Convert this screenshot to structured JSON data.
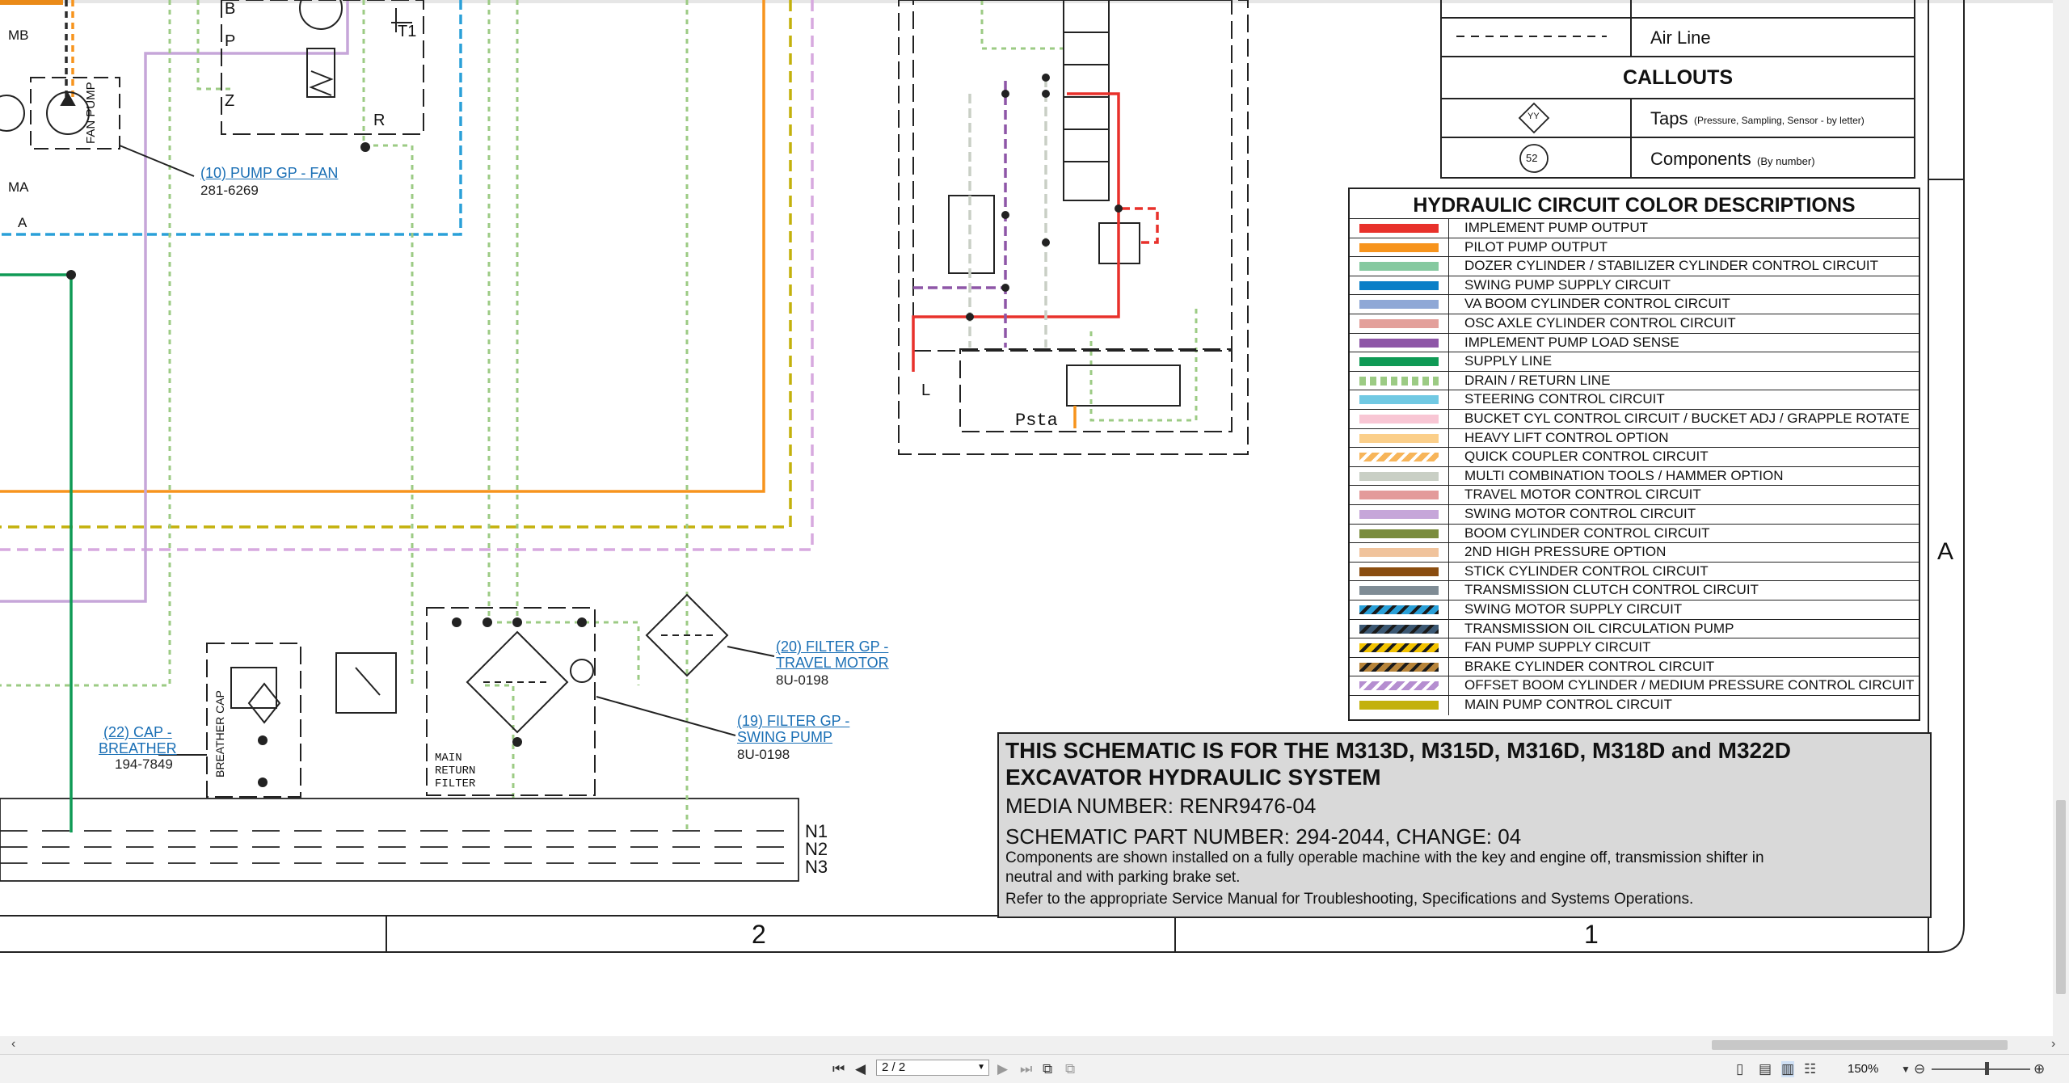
{
  "legend_top": {
    "air_line_label": "Air Line",
    "callouts_header": "CALLOUTS",
    "taps_label": "Taps",
    "taps_note": "(Pressure, Sampling, Sensor - by letter)",
    "taps_symbol": "YY",
    "components_label": "Components",
    "components_note": "(By number)",
    "components_symbol": "52"
  },
  "color_descriptions": {
    "title": "HYDRAULIC CIRCUIT COLOR DESCRIPTIONS",
    "rows": [
      {
        "label": "IMPLEMENT PUMP OUTPUT",
        "color": "#e8312b",
        "pattern": "solid"
      },
      {
        "label": "PILOT PUMP OUTPUT",
        "color": "#f7941d",
        "pattern": "solid"
      },
      {
        "label": "DOZER CYLINDER / STABILIZER CYLINDER CONTROL CIRCUIT",
        "color": "#86c9a0",
        "pattern": "solid"
      },
      {
        "label": "SWING PUMP SUPPLY CIRCUIT",
        "color": "#0b7fc7",
        "pattern": "solid"
      },
      {
        "label": "VA BOOM CYLINDER CONTROL CIRCUIT",
        "color": "#8fa8d6",
        "pattern": "solid"
      },
      {
        "label": "OSC AXLE CYLINDER CONTROL CIRCUIT",
        "color": "#e3a09b",
        "pattern": "solid"
      },
      {
        "label": "IMPLEMENT PUMP LOAD SENSE",
        "color": "#8e56a7",
        "pattern": "solid"
      },
      {
        "label": "SUPPLY LINE",
        "color": "#0f9a55",
        "pattern": "solid"
      },
      {
        "label": "DRAIN / RETURN LINE",
        "color": "#9ccb84",
        "pattern": "dotted"
      },
      {
        "label": "STEERING CONTROL CIRCUIT",
        "color": "#71c9e3",
        "pattern": "solid"
      },
      {
        "label": "BUCKET CYL CONTROL CIRCUIT / BUCKET ADJ / GRAPPLE ROTATE",
        "color": "#f8c6d4",
        "pattern": "solid"
      },
      {
        "label": "HEAVY LIFT CONTROL OPTION",
        "color": "#fbcf8a",
        "pattern": "solid"
      },
      {
        "label": "QUICK COUPLER CONTROL CIRCUIT",
        "color": "#f7b55a",
        "pattern": "hatch"
      },
      {
        "label": "MULTI COMBINATION TOOLS / HAMMER OPTION",
        "color": "#c9cfc5",
        "pattern": "solid"
      },
      {
        "label": "TRAVEL MOTOR CONTROL CIRCUIT",
        "color": "#e39a9a",
        "pattern": "solid"
      },
      {
        "label": "SWING MOTOR CONTROL CIRCUIT",
        "color": "#c6a6d9",
        "pattern": "solid"
      },
      {
        "label": "BOOM CYLINDER CONTROL CIRCUIT",
        "color": "#7a8c3d",
        "pattern": "solid"
      },
      {
        "label": "2ND HIGH PRESSURE OPTION",
        "color": "#f0c39c",
        "pattern": "solid"
      },
      {
        "label": "STICK CYLINDER CONTROL CIRCUIT",
        "color": "#8a4d10",
        "pattern": "solid"
      },
      {
        "label": "TRANSMISSION CLUTCH CONTROL CIRCUIT",
        "color": "#7f8c95",
        "pattern": "solid"
      },
      {
        "label": "SWING MOTOR SUPPLY CIRCUIT",
        "color": "#2aa0d8",
        "pattern": "stripe-dark"
      },
      {
        "label": "TRANSMISSION OIL CIRCULATION PUMP",
        "color": "#3c5873",
        "pattern": "stripe-dark"
      },
      {
        "label": "FAN PUMP SUPPLY CIRCUIT",
        "color": "#f2c200",
        "pattern": "stripe-dark"
      },
      {
        "label": "BRAKE CYLINDER CONTROL CIRCUIT",
        "color": "#b7843a",
        "pattern": "stripe-dark"
      },
      {
        "label": "OFFSET BOOM CYLINDER / MEDIUM PRESSURE CONTROL CIRCUIT",
        "color": "#b58ed0",
        "pattern": "hatch"
      },
      {
        "label": "MAIN PUMP CONTROL CIRCUIT",
        "color": "#c3b10c",
        "pattern": "solid"
      }
    ]
  },
  "title_block": {
    "line1": "THIS SCHEMATIC IS FOR THE M313D, M315D, M316D, M318D and M322D EXCAVATOR HYDRAULIC SYSTEM",
    "media_number": "MEDIA NUMBER: RENR9476-04",
    "part_number": "SCHEMATIC PART NUMBER: 294-2044, CHANGE: 04",
    "note": "Components are shown installed on a fully operable machine with the key and engine off, transmission shifter in neutral and with parking brake set.",
    "reference": "Refer to the appropriate Service Manual for Troubleshooting, Specifications and Systems Operations."
  },
  "callouts": {
    "pump_fan": {
      "label": "(10) PUMP GP - FAN",
      "part": "281-6269"
    },
    "filter_travel_line1": "(20) FILTER GP -",
    "filter_travel_line2": "TRAVEL MOTOR",
    "filter_travel_part": "8U-0198",
    "filter_swing_line1": "(19) FILTER GP -",
    "filter_swing_line2": "SWING PUMP",
    "filter_swing_part": "8U-0198",
    "cap_line1": "(22) CAP -",
    "cap_line2": "BREATHER",
    "cap_part": "194-7849"
  },
  "schematic_labels": {
    "mb": "MB",
    "b": "B",
    "p": "P",
    "t1": "T1",
    "z": "Z",
    "r": "R",
    "ma": "MA",
    "a": "A",
    "fan_pump": "FAN PUMP",
    "l": "L",
    "psta": "Psta",
    "breather_cap": "BREATHER CAP",
    "main_return_filter_1": "MAIN",
    "main_return_filter_2": "RETURN",
    "main_return_filter_3": "FILTER",
    "n1": "N1",
    "n2": "N2",
    "n3": "N3"
  },
  "border": {
    "zone_row": "A",
    "zone_col_2": "2",
    "zone_col_1": "1"
  },
  "viewer": {
    "page_indicator": "2 / 2",
    "zoom": "150%",
    "first_page_icon": "first-page-icon",
    "prev_page_icon": "prev-page-icon",
    "next_page_icon": "next-page-icon",
    "last_page_icon": "last-page-icon"
  }
}
